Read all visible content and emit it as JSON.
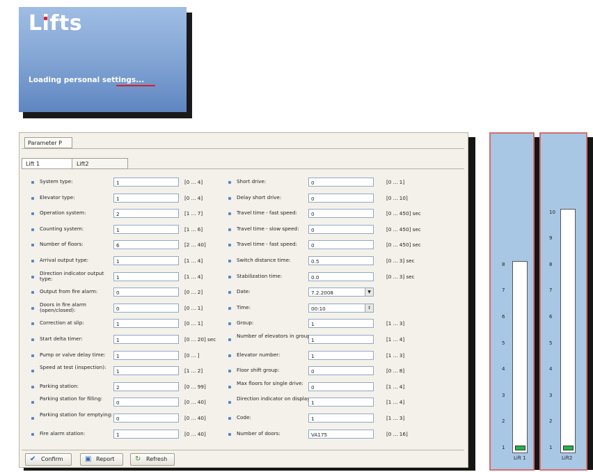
{
  "splash": {
    "title": "Lifts",
    "message": "Loading personal settings...",
    "brand_color": "#86a8d6",
    "accent": "#d51f2a"
  },
  "dialog": {
    "tab_title": "Parameter P",
    "lift_tabs": [
      "Lift 1",
      "Lift2"
    ],
    "left_column": [
      {
        "label": "System type:",
        "value": "1",
        "range": "[0 ... 4]"
      },
      {
        "label": "Elevator type:",
        "value": "1",
        "range": "[0 ... 4]"
      },
      {
        "label": "Operation system:",
        "value": "2",
        "range": "[1 ... 7]"
      },
      {
        "label": "Counting system:",
        "value": "1",
        "range": "[1 ... 6]"
      },
      {
        "label": "Number of floors:",
        "value": "6",
        "range": "[2 ... 40]"
      },
      {
        "label": "Arrival output type:",
        "value": "1",
        "range": "[1 ... 4]"
      },
      {
        "label": "Direction indicator output type:",
        "value": "1",
        "range": "[1 ... 4]"
      },
      {
        "label": "Output from fire alarm:",
        "value": "0",
        "range": "[0 ... 2]"
      },
      {
        "label": "Doors in fire alarm (open/closed):",
        "value": "0",
        "range": "[0 ... 1]"
      },
      {
        "label": "Correction at slip:",
        "value": "1",
        "range": "[0 ... 1]"
      },
      {
        "label": "Start delta timer:",
        "value": "1",
        "range": "[0 ... 20] sec"
      },
      {
        "label": "Pump or valve delay time:",
        "value": "1",
        "range": "[0 ... ]"
      },
      {
        "label": "Speed at test (inspection):",
        "value": "1",
        "range": "[1 ... 2]"
      },
      {
        "label": "Parking station:",
        "value": "2",
        "range": "[0 ... 99]"
      },
      {
        "label": "Parking station for filling:",
        "value": "0",
        "range": "[0 ... 40]"
      },
      {
        "label": "Parking station for emptying:",
        "value": "0",
        "range": "[0 ... 40]"
      },
      {
        "label": "Fire alarm station:",
        "value": "1",
        "range": "[0 ... 40]"
      }
    ],
    "right_column": [
      {
        "label": "Short drive:",
        "value": "0",
        "range": "[0 ... 1]"
      },
      {
        "label": "Delay short drive:",
        "value": "0",
        "range": "[0 ... 10]"
      },
      {
        "label": "Travel time - fast speed:",
        "value": "0",
        "range": "[0 ... 450] sec"
      },
      {
        "label": "Travel time - slow speed:",
        "value": "0",
        "range": "[0 ... 450] sec"
      },
      {
        "label": "Travel time - fast speed:",
        "value": "0",
        "range": "[0 ... 450] sec"
      },
      {
        "label": "Switch distance time:",
        "value": "0.5",
        "range": "[0 ... 3] sec"
      },
      {
        "label": "Stabilization time:",
        "value": "0.0",
        "range": "[0 ... 3] sec"
      },
      {
        "label": "Date:",
        "value": "7.2.2008",
        "range": "",
        "control": "dropdown"
      },
      {
        "label": "Time:",
        "value": "00:10",
        "range": "",
        "control": "spinner"
      },
      {
        "label": "Group:",
        "value": "1",
        "range": "[1 ... 3]"
      },
      {
        "label": "Number of elevators in group:",
        "value": "1",
        "range": "[1 ... 4]"
      },
      {
        "label": "Elevator number:",
        "value": "1",
        "range": "[1 ... 3]"
      },
      {
        "label": "Floor shift group:",
        "value": "0",
        "range": "[0 ... 8]"
      },
      {
        "label": "Max floors for single drive:",
        "value": "0",
        "range": "[1 ... 4]"
      },
      {
        "label": "Direction indicator on display:",
        "value": "1",
        "range": "[1 ... 4]"
      },
      {
        "label": "Code:",
        "value": "1",
        "range": "[1 ... 3]"
      },
      {
        "label": "Number of doors:",
        "value": "VA175",
        "range": "[0 ... 16]"
      }
    ],
    "buttons": {
      "confirm": "Confirm",
      "report": "Report",
      "refresh": "Refresh"
    }
  },
  "lifts": [
    {
      "name": "Lift 1",
      "floors": [
        "8",
        "7",
        "6",
        "5",
        "4",
        "3",
        "2",
        "1"
      ],
      "current_floor": 1
    },
    {
      "name": "Lift2",
      "floors": [
        "10",
        "9",
        "8",
        "7",
        "6",
        "5",
        "4",
        "3",
        "2",
        "1"
      ],
      "current_floor": 1
    }
  ],
  "colors": {
    "lift_panel_bg": "#a8c7e4",
    "lift_panel_border": "#d36e6e",
    "car_color": "#27b04c",
    "bullet": "#5a86c8"
  }
}
